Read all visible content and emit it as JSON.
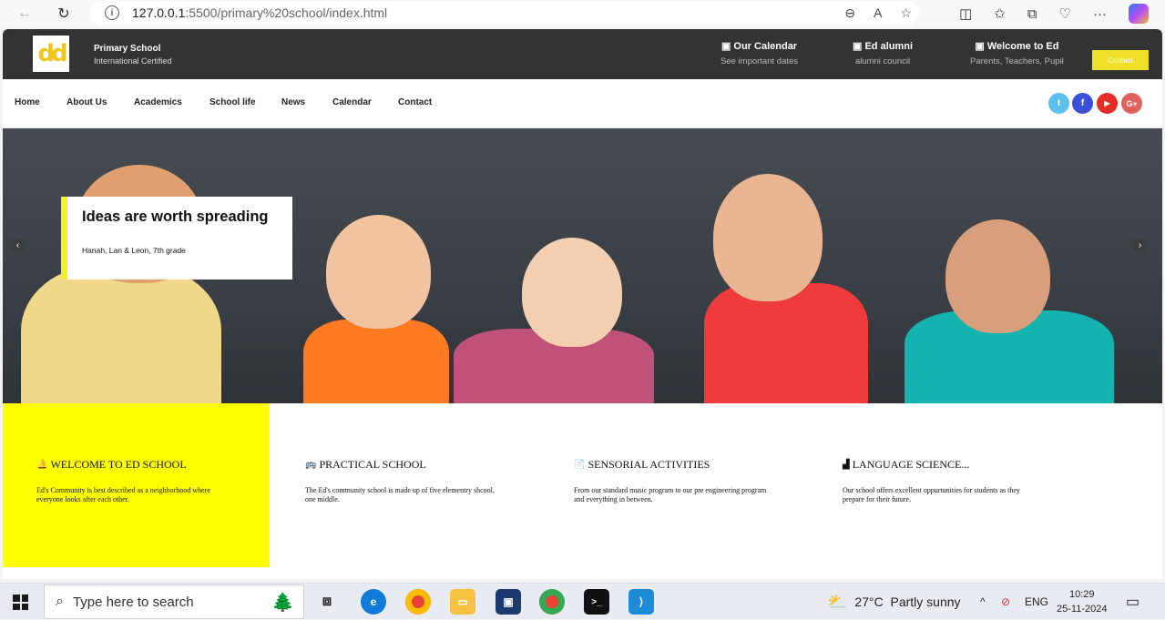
{
  "browser": {
    "url_host": "127.0.0.1",
    "url_path": ":5500/primary%20school/index.html"
  },
  "header": {
    "school_name": "Primary School",
    "school_sub": "International Certified",
    "logo_text": "dd",
    "info": [
      {
        "title": "Our Calendar",
        "sub": "See important dates"
      },
      {
        "title": "Ed alumni",
        "sub": "alumni council"
      },
      {
        "title": "Welcome to Ed",
        "sub": "Parents, Teachers, Pupil"
      }
    ],
    "contact_label": "Contact"
  },
  "nav": {
    "links": [
      "Home",
      "About Us",
      "Academics",
      "School life",
      "News",
      "Calendar",
      "Contact"
    ]
  },
  "social": [
    {
      "icon": "twitter-icon",
      "glyph": "t",
      "color": "#5bc0eb"
    },
    {
      "icon": "facebook-icon",
      "glyph": "f",
      "color": "#3b4fd8"
    },
    {
      "icon": "youtube-icon",
      "glyph": "▶",
      "color": "#e52d27"
    },
    {
      "icon": "google-plus-icon",
      "glyph": "G+",
      "color": "#e06060"
    }
  ],
  "hero": {
    "caption_title": "Ideas are worth spreading",
    "caption_sub": "Hanah, Lan & Leon, 7th grade",
    "prev": "‹",
    "next": "›"
  },
  "features": [
    {
      "icon": "bell-icon",
      "glyph": "🔔",
      "title": "WELCOME TO ED SCHOOL",
      "desc": "Ed's Community is best described as a neighborhood where everyone looks after each other."
    },
    {
      "icon": "bus-icon",
      "glyph": "🚌",
      "title": "PRACTICAL SCHOOL",
      "desc": "The Ed's community school is made up of five elementry shcool, one middle."
    },
    {
      "icon": "file-icon",
      "glyph": "📄",
      "title": "SENSORIAL ACTIVITIES",
      "desc": "From our standard music program to our pre engineering program and everything in between."
    },
    {
      "icon": "chart-icon",
      "glyph": "▟",
      "title": "LANGUAGE SCIENCE...",
      "desc": "Our school offers excellent oppurtunities for students as they prepare for their future."
    }
  ],
  "taskbar": {
    "search_placeholder": "Type here to search",
    "weather_temp": "27°C",
    "weather_text": "Partly sunny",
    "lang": "ENG",
    "time": "10:29",
    "date": "25-11-2024"
  },
  "colors": {
    "topbar": "#333333",
    "accent_yellow": "#ffff00",
    "contact_btn": "#f0e028"
  }
}
